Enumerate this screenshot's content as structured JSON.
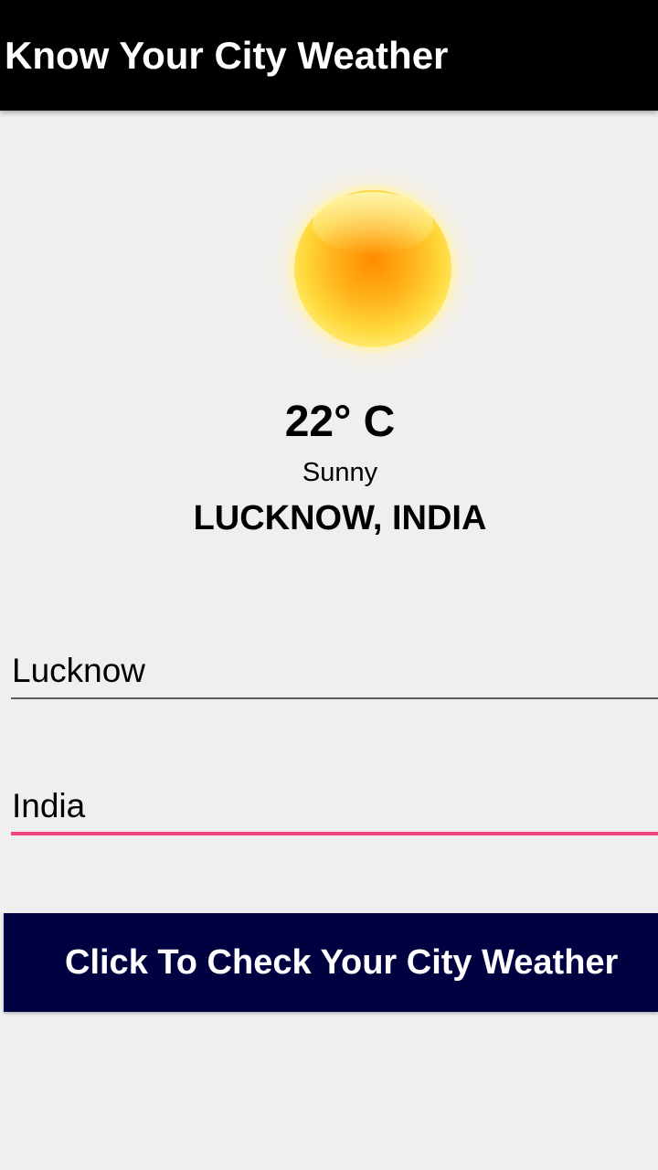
{
  "app": {
    "title": "Know Your City Weather"
  },
  "weather": {
    "icon": "sun-icon",
    "temperature": "22° C",
    "condition": "Sunny",
    "location": "LUCKNOW, INDIA"
  },
  "form": {
    "city_value": "Lucknow",
    "country_value": "India",
    "submit_label": "Click To Check Your City Weather"
  },
  "colors": {
    "app_bar": "#000000",
    "background": "#efefef",
    "button": "#000140",
    "focused_underline": "#ee4481",
    "default_underline": "#5a5a5a"
  }
}
